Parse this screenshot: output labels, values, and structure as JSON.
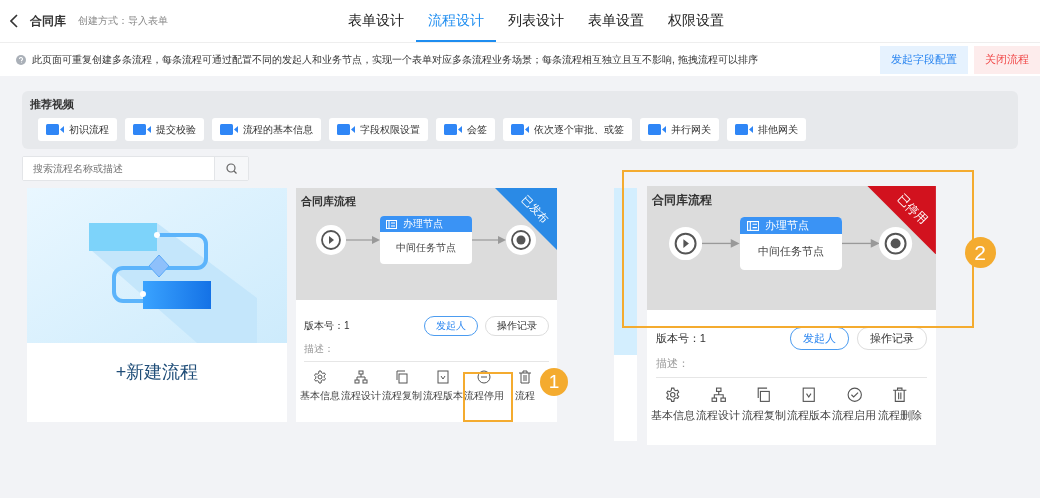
{
  "header": {
    "title": "合同库",
    "subtitle": "创建方式：导入表单",
    "tabs": [
      {
        "label": "表单设计",
        "selected": false
      },
      {
        "label": "流程设计",
        "selected": true
      },
      {
        "label": "列表设计",
        "selected": false
      },
      {
        "label": "表单设置",
        "selected": false
      },
      {
        "label": "权限设置",
        "selected": false
      }
    ]
  },
  "notice": {
    "text": "此页面可重复创建多条流程，每条流程可通过配置不同的发起人和业务节点，实现一个表单对应多条流程业务场景；每条流程相互独立且互不影响, 拖拽流程可以排序",
    "buttons": [
      {
        "label": "发起字段配置",
        "kind": "primary"
      },
      {
        "label": "关闭流程",
        "kind": "danger"
      }
    ]
  },
  "videos": {
    "title": "推荐视频",
    "items": [
      "初识流程",
      "提交校验",
      "流程的基本信息",
      "字段权限设置",
      "会签",
      "依次逐个审批、或签",
      "并行网关",
      "排他网关"
    ]
  },
  "search": {
    "placeholder": "搜索流程名称或描述"
  },
  "new_card": {
    "label": "+新建流程"
  },
  "flows": [
    {
      "title": "合同库流程",
      "status": "已发布",
      "color": "#2a8ae6",
      "node_title": "办理节点",
      "node_body": "中间任务节点",
      "version": "版本号：1",
      "launcher": "发起人",
      "log": "操作记录",
      "desc": "描述：",
      "actions": [
        {
          "label": "基本信息",
          "kind": "info"
        },
        {
          "label": "流程设计",
          "kind": "design"
        },
        {
          "label": "流程复制",
          "kind": "copy"
        },
        {
          "label": "流程版本",
          "kind": "version"
        },
        {
          "label": "流程停用",
          "kind": "disable",
          "callout": "1"
        },
        {
          "label": "流程",
          "kind": "delete"
        }
      ]
    },
    {
      "title": "合同库流程",
      "status": "已停用",
      "color": "#d2121e",
      "callout": "2",
      "node_title": "办理节点",
      "node_body": "中间任务节点",
      "version": "版本号：1",
      "launcher": "发起人",
      "log": "操作记录",
      "desc": "描述：",
      "actions": [
        {
          "label": "基本信息",
          "kind": "info"
        },
        {
          "label": "流程设计",
          "kind": "design"
        },
        {
          "label": "流程复制",
          "kind": "copy"
        },
        {
          "label": "流程版本",
          "kind": "version"
        },
        {
          "label": "流程启用",
          "kind": "enable"
        },
        {
          "label": "流程删除",
          "kind": "delete"
        }
      ]
    }
  ]
}
